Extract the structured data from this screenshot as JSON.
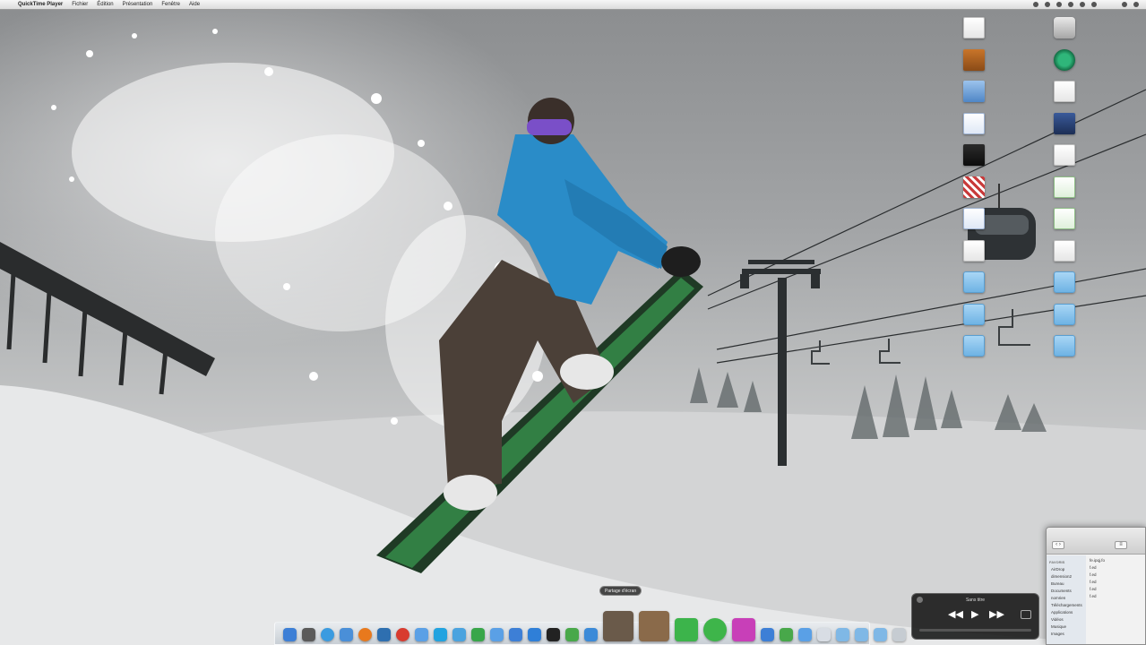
{
  "menubar": {
    "apple_glyph": "",
    "app_name": "QuickTime Player",
    "menus": [
      "Fichier",
      "Édition",
      "Présentation",
      "Fenêtre",
      "Aide"
    ],
    "status": [
      "",
      "",
      "",
      "",
      "",
      "",
      "",
      ""
    ]
  },
  "tooltip": {
    "text": "Partage d'écran"
  },
  "quicktime": {
    "title": "Sans titre",
    "rewind_glyph": "◀◀",
    "play_glyph": "▶",
    "forward_glyph": "▶▶"
  },
  "finder": {
    "back_glyph": "‹ ›",
    "view_glyph": "≡",
    "sidebar_head": "FAVORIS",
    "sidebar": [
      "AirDrop",
      "dimension2",
      "Bureau",
      "Documents",
      "nomrien",
      "Téléchargements",
      "Applications",
      "Vidéos",
      "Musique",
      "Images"
    ],
    "rows": [
      "",
      "fe.ipqj.fo",
      "",
      "",
      "f.ed",
      "f.ed",
      "",
      "f.ed",
      "f.ed",
      "",
      "f.ed"
    ]
  },
  "desktop_icons": [
    {
      "label": "",
      "kind": "doc"
    },
    {
      "label": "",
      "kind": "drive"
    },
    {
      "label": "",
      "kind": "img-orange"
    },
    {
      "label": "",
      "kind": "timemachine"
    },
    {
      "label": "",
      "kind": "img-blue"
    },
    {
      "label": "",
      "kind": "doc"
    },
    {
      "label": "",
      "kind": "doc-blue"
    },
    {
      "label": "",
      "kind": "pic"
    },
    {
      "label": "",
      "kind": "img-dark"
    },
    {
      "label": "",
      "kind": "doc"
    },
    {
      "label": "",
      "kind": "img-red"
    },
    {
      "label": "",
      "kind": "doc-green"
    },
    {
      "label": "",
      "kind": "doc-blue"
    },
    {
      "label": "",
      "kind": "doc-green"
    },
    {
      "label": "",
      "kind": "doc"
    },
    {
      "label": "",
      "kind": "doc"
    },
    {
      "label": "",
      "kind": "folder"
    },
    {
      "label": "",
      "kind": "folder"
    },
    {
      "label": "",
      "kind": "folder"
    },
    {
      "label": "",
      "kind": "folder"
    },
    {
      "label": "",
      "kind": "folder"
    },
    {
      "label": "",
      "kind": "folder"
    }
  ],
  "dock": [
    {
      "name": "finder-icon",
      "color": "#3d7fd6"
    },
    {
      "name": "launchpad-icon",
      "color": "#5a5a5a"
    },
    {
      "name": "safari-icon",
      "color": "#3a9be0"
    },
    {
      "name": "mail-icon",
      "color": "#4a8fd8"
    },
    {
      "name": "firefox-icon",
      "color": "#e8791d"
    },
    {
      "name": "xcode-icon",
      "color": "#2e6fb0"
    },
    {
      "name": "chrome-icon",
      "color": "#d83b2f"
    },
    {
      "name": "itunes-icon",
      "color": "#5aa0e6"
    },
    {
      "name": "skype-icon",
      "color": "#21a3e0"
    },
    {
      "name": "twitter-icon",
      "color": "#4aa3df"
    },
    {
      "name": "messages-icon",
      "color": "#38a64a"
    },
    {
      "name": "facetime-icon",
      "color": "#5aa0e6"
    },
    {
      "name": "appstore-icon",
      "color": "#3d7fd6"
    },
    {
      "name": "dropbox-icon",
      "color": "#2f7fd8"
    },
    {
      "name": "terminal-icon",
      "color": "#222222"
    },
    {
      "name": "evernote-icon",
      "color": "#48a84a"
    },
    {
      "name": "qt-icon",
      "color": "#3b8ad8"
    },
    {
      "name": "contact-photo-icon",
      "color": "#6a5a4a"
    },
    {
      "name": "screen-sharing-icon",
      "color": "#8a6a4a"
    },
    {
      "name": "numbers-icon",
      "color": "#3cb44b"
    },
    {
      "name": "checkmark-app-icon",
      "color": "#3eb54a"
    },
    {
      "name": "design-app-icon",
      "color": "#c83fb8"
    },
    {
      "name": "preview-icon",
      "color": "#3d7fd6"
    },
    {
      "name": "calculator-icon",
      "color": "#48a84a"
    },
    {
      "name": "downloads-stack-icon",
      "color": "#5aa0e6"
    },
    {
      "name": "documents-stack-icon",
      "color": "#d8dde4"
    },
    {
      "name": "applications-stack-icon",
      "color": "#7fb8e6"
    },
    {
      "name": "folder-stack-icon",
      "color": "#7fb8e6"
    },
    {
      "name": "folder-stack-icon-2",
      "color": "#7fb8e6"
    },
    {
      "name": "trash-icon",
      "color": "#c6ccd2"
    }
  ]
}
